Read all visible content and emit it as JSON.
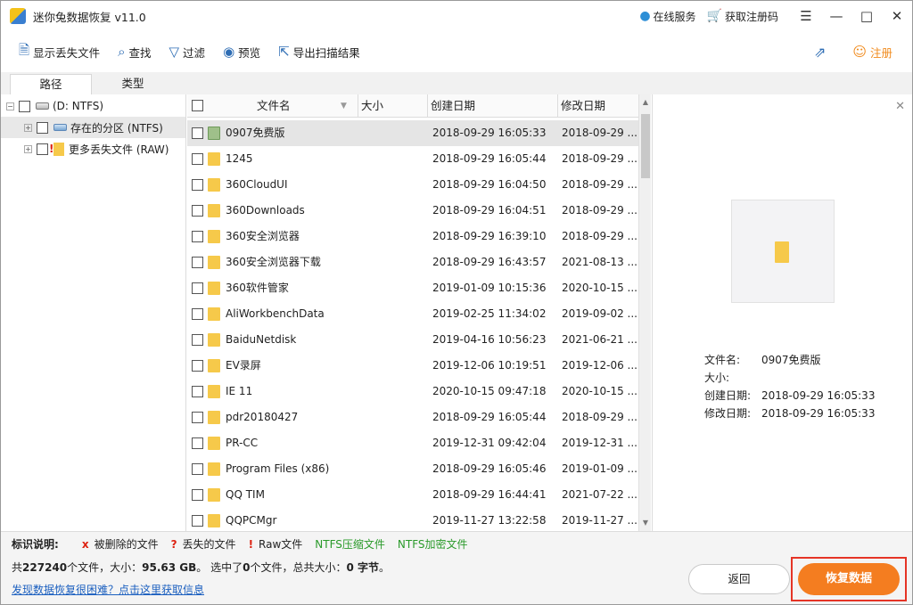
{
  "window": {
    "title": "迷你兔数据恢复 v11.0"
  },
  "titlebar": {
    "online_service": "在线服务",
    "get_code": "获取注册码"
  },
  "toolbar": {
    "show_lost": "显示丢失文件",
    "find": "查找",
    "filter": "过滤",
    "preview": "预览",
    "export": "导出扫描结果",
    "register": "注册"
  },
  "tabs": [
    {
      "label": "路径"
    },
    {
      "label": "类型"
    }
  ],
  "tree": {
    "root": "(D: NTFS)",
    "items": [
      {
        "label": "存在的分区 (NTFS)"
      },
      {
        "label": "更多丢失文件 (RAW)"
      }
    ]
  },
  "columns": {
    "name": "文件名",
    "size": "大小",
    "created": "创建日期",
    "modified": "修改日期"
  },
  "files": [
    {
      "name": "0907免费版",
      "created": "2018-09-29 16:05:33",
      "modified": "2018-09-29 ..."
    },
    {
      "name": "1245",
      "created": "2018-09-29 16:05:44",
      "modified": "2018-09-29 ..."
    },
    {
      "name": "360CloudUI",
      "created": "2018-09-29 16:04:50",
      "modified": "2018-09-29 ..."
    },
    {
      "name": "360Downloads",
      "created": "2018-09-29 16:04:51",
      "modified": "2018-09-29 ..."
    },
    {
      "name": "360安全浏览器",
      "created": "2018-09-29 16:39:10",
      "modified": "2018-09-29 ..."
    },
    {
      "name": "360安全浏览器下载",
      "created": "2018-09-29 16:43:57",
      "modified": "2021-08-13 ..."
    },
    {
      "name": "360软件管家",
      "created": "2019-01-09 10:15:36",
      "modified": "2020-10-15 ..."
    },
    {
      "name": "AliWorkbenchData",
      "created": "2019-02-25 11:34:02",
      "modified": "2019-09-02 ..."
    },
    {
      "name": "BaiduNetdisk",
      "created": "2019-04-16 10:56:23",
      "modified": "2021-06-21 ..."
    },
    {
      "name": "EV录屏",
      "created": "2019-12-06 10:19:51",
      "modified": "2019-12-06 ..."
    },
    {
      "name": "IE 11",
      "created": "2020-10-15 09:47:18",
      "modified": "2020-10-15 ..."
    },
    {
      "name": "pdr20180427",
      "created": "2018-09-29 16:05:44",
      "modified": "2018-09-29 ..."
    },
    {
      "name": "PR-CC",
      "created": "2019-12-31 09:42:04",
      "modified": "2019-12-31 ..."
    },
    {
      "name": "Program Files (x86)",
      "created": "2018-09-29 16:05:46",
      "modified": "2019-01-09 ..."
    },
    {
      "name": "QQ TIM",
      "created": "2018-09-29 16:44:41",
      "modified": "2021-07-22 ..."
    },
    {
      "name": "QQPCMgr",
      "created": "2019-11-27 13:22:58",
      "modified": "2019-11-27 ..."
    }
  ],
  "preview": {
    "name_label": "文件名:",
    "name": "0907免费版",
    "size_label": "大小:",
    "created_label": "创建日期:",
    "created": "2018-09-29 16:05:33",
    "modified_label": "修改日期:",
    "modified": "2018-09-29 16:05:33"
  },
  "legend": {
    "title": "标识说明:",
    "deleted_mark": "x",
    "deleted": "被删除的文件",
    "lost_mark": "?",
    "lost": "丢失的文件",
    "raw_mark": "!",
    "raw": "Raw文件",
    "compressed": "NTFS压缩文件",
    "encrypted": "NTFS加密文件"
  },
  "stats": {
    "p1": "共",
    "total": "227240",
    "p2": "个文件，大小：",
    "size": "95.63 GB",
    "p3": "。 选中了",
    "selected": "0",
    "p4": "个文件，总共大小：",
    "sel_size": "0 字节",
    "p5": "。"
  },
  "help_link": "发现数据恢复很困难？点击这里获取信息",
  "buttons": {
    "back": "返回",
    "recover": "恢复数据"
  },
  "colors": {
    "accent": "#f47d20",
    "highlight_border": "#e53426",
    "link": "#1b5fbf"
  }
}
